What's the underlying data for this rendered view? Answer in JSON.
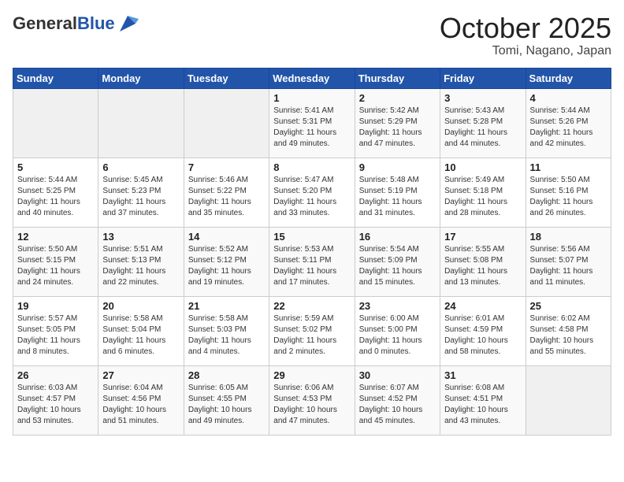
{
  "header": {
    "logo_general": "General",
    "logo_blue": "Blue",
    "month": "October 2025",
    "location": "Tomi, Nagano, Japan"
  },
  "weekdays": [
    "Sunday",
    "Monday",
    "Tuesday",
    "Wednesday",
    "Thursday",
    "Friday",
    "Saturday"
  ],
  "weeks": [
    [
      {
        "day": "",
        "info": ""
      },
      {
        "day": "",
        "info": ""
      },
      {
        "day": "",
        "info": ""
      },
      {
        "day": "1",
        "info": "Sunrise: 5:41 AM\nSunset: 5:31 PM\nDaylight: 11 hours\nand 49 minutes."
      },
      {
        "day": "2",
        "info": "Sunrise: 5:42 AM\nSunset: 5:29 PM\nDaylight: 11 hours\nand 47 minutes."
      },
      {
        "day": "3",
        "info": "Sunrise: 5:43 AM\nSunset: 5:28 PM\nDaylight: 11 hours\nand 44 minutes."
      },
      {
        "day": "4",
        "info": "Sunrise: 5:44 AM\nSunset: 5:26 PM\nDaylight: 11 hours\nand 42 minutes."
      }
    ],
    [
      {
        "day": "5",
        "info": "Sunrise: 5:44 AM\nSunset: 5:25 PM\nDaylight: 11 hours\nand 40 minutes."
      },
      {
        "day": "6",
        "info": "Sunrise: 5:45 AM\nSunset: 5:23 PM\nDaylight: 11 hours\nand 37 minutes."
      },
      {
        "day": "7",
        "info": "Sunrise: 5:46 AM\nSunset: 5:22 PM\nDaylight: 11 hours\nand 35 minutes."
      },
      {
        "day": "8",
        "info": "Sunrise: 5:47 AM\nSunset: 5:20 PM\nDaylight: 11 hours\nand 33 minutes."
      },
      {
        "day": "9",
        "info": "Sunrise: 5:48 AM\nSunset: 5:19 PM\nDaylight: 11 hours\nand 31 minutes."
      },
      {
        "day": "10",
        "info": "Sunrise: 5:49 AM\nSunset: 5:18 PM\nDaylight: 11 hours\nand 28 minutes."
      },
      {
        "day": "11",
        "info": "Sunrise: 5:50 AM\nSunset: 5:16 PM\nDaylight: 11 hours\nand 26 minutes."
      }
    ],
    [
      {
        "day": "12",
        "info": "Sunrise: 5:50 AM\nSunset: 5:15 PM\nDaylight: 11 hours\nand 24 minutes."
      },
      {
        "day": "13",
        "info": "Sunrise: 5:51 AM\nSunset: 5:13 PM\nDaylight: 11 hours\nand 22 minutes."
      },
      {
        "day": "14",
        "info": "Sunrise: 5:52 AM\nSunset: 5:12 PM\nDaylight: 11 hours\nand 19 minutes."
      },
      {
        "day": "15",
        "info": "Sunrise: 5:53 AM\nSunset: 5:11 PM\nDaylight: 11 hours\nand 17 minutes."
      },
      {
        "day": "16",
        "info": "Sunrise: 5:54 AM\nSunset: 5:09 PM\nDaylight: 11 hours\nand 15 minutes."
      },
      {
        "day": "17",
        "info": "Sunrise: 5:55 AM\nSunset: 5:08 PM\nDaylight: 11 hours\nand 13 minutes."
      },
      {
        "day": "18",
        "info": "Sunrise: 5:56 AM\nSunset: 5:07 PM\nDaylight: 11 hours\nand 11 minutes."
      }
    ],
    [
      {
        "day": "19",
        "info": "Sunrise: 5:57 AM\nSunset: 5:05 PM\nDaylight: 11 hours\nand 8 minutes."
      },
      {
        "day": "20",
        "info": "Sunrise: 5:58 AM\nSunset: 5:04 PM\nDaylight: 11 hours\nand 6 minutes."
      },
      {
        "day": "21",
        "info": "Sunrise: 5:58 AM\nSunset: 5:03 PM\nDaylight: 11 hours\nand 4 minutes."
      },
      {
        "day": "22",
        "info": "Sunrise: 5:59 AM\nSunset: 5:02 PM\nDaylight: 11 hours\nand 2 minutes."
      },
      {
        "day": "23",
        "info": "Sunrise: 6:00 AM\nSunset: 5:00 PM\nDaylight: 11 hours\nand 0 minutes."
      },
      {
        "day": "24",
        "info": "Sunrise: 6:01 AM\nSunset: 4:59 PM\nDaylight: 10 hours\nand 58 minutes."
      },
      {
        "day": "25",
        "info": "Sunrise: 6:02 AM\nSunset: 4:58 PM\nDaylight: 10 hours\nand 55 minutes."
      }
    ],
    [
      {
        "day": "26",
        "info": "Sunrise: 6:03 AM\nSunset: 4:57 PM\nDaylight: 10 hours\nand 53 minutes."
      },
      {
        "day": "27",
        "info": "Sunrise: 6:04 AM\nSunset: 4:56 PM\nDaylight: 10 hours\nand 51 minutes."
      },
      {
        "day": "28",
        "info": "Sunrise: 6:05 AM\nSunset: 4:55 PM\nDaylight: 10 hours\nand 49 minutes."
      },
      {
        "day": "29",
        "info": "Sunrise: 6:06 AM\nSunset: 4:53 PM\nDaylight: 10 hours\nand 47 minutes."
      },
      {
        "day": "30",
        "info": "Sunrise: 6:07 AM\nSunset: 4:52 PM\nDaylight: 10 hours\nand 45 minutes."
      },
      {
        "day": "31",
        "info": "Sunrise: 6:08 AM\nSunset: 4:51 PM\nDaylight: 10 hours\nand 43 minutes."
      },
      {
        "day": "",
        "info": ""
      }
    ]
  ]
}
